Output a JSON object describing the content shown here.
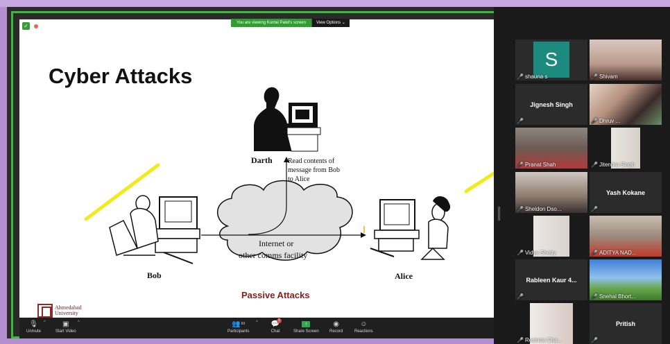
{
  "banner": {
    "message": "You are viewing Kuntal Patel's screen",
    "options": "View Options ⌄"
  },
  "slide": {
    "title": "Cyber Attacks",
    "labels": {
      "darth": "Darth",
      "read_line1": "Read contents of",
      "read_line2": "message from Bob",
      "read_line3": "to Alice",
      "cloud_line1": "Internet or",
      "cloud_line2": "other comms facility",
      "bob": "Bob",
      "alice": "Alice"
    },
    "caption": "Passive Attacks",
    "logo_line1": "Ahmedabad",
    "logo_line2": "University"
  },
  "toolbar": {
    "unmute": "Unmute",
    "start_video": "Start Video",
    "participants": "Participants",
    "participants_count": "69",
    "chat": "Chat",
    "chat_badge": "1",
    "share_screen": "Share Screen",
    "record": "Record",
    "reactions": "Reactions"
  },
  "gallery": {
    "tiles": [
      {
        "name": "shauna s",
        "avatar_letter": "S"
      },
      {
        "name": "Shivam"
      },
      {
        "name": "Jignesh Singh",
        "centered": true
      },
      {
        "name": "Dhruv ..."
      },
      {
        "name": "Pranat Shah"
      },
      {
        "name": "Jitendra Singh"
      },
      {
        "name": "Sheldon Dso..."
      },
      {
        "name": "Yash Kokane",
        "centered": true
      },
      {
        "name": "Vidya Shetty"
      },
      {
        "name": "ADITYA NAD..."
      },
      {
        "name": "Rableen Kaur 4...",
        "centered": true
      },
      {
        "name": "Snehal Bhort..."
      },
      {
        "name": "Reshma Cha..."
      },
      {
        "name": "Pritish",
        "centered": true
      }
    ]
  },
  "colors": {
    "share_border": "#3db83a",
    "highlight_tick": "#f2ea1a",
    "caption": "#8b1a1a",
    "avatar_bg": "#1d8a80"
  }
}
